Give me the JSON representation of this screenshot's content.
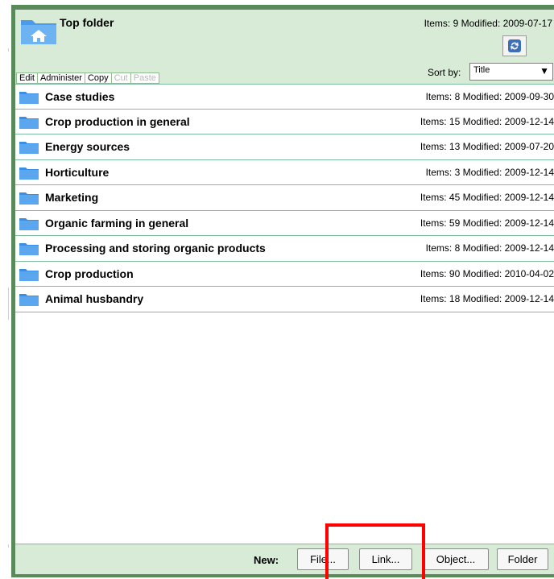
{
  "header": {
    "title": "Top folder",
    "meta": "Items: 9  Modified: 2009-07-17",
    "refresh_icon": "refresh-icon",
    "home_icon": "home-folder-icon",
    "sort_label": "Sort by:",
    "sort_value": "Title"
  },
  "actions": [
    {
      "label": "Edit",
      "enabled": true
    },
    {
      "label": "Administer",
      "enabled": true
    },
    {
      "label": "Copy",
      "enabled": true
    },
    {
      "label": "Cut",
      "enabled": false
    },
    {
      "label": "Paste",
      "enabled": false
    }
  ],
  "folders": [
    {
      "name": "Case studies",
      "meta": "Items: 8  Modified: 2009-09-30"
    },
    {
      "name": "Crop production in general",
      "meta": "Items: 15  Modified: 2009-12-14"
    },
    {
      "name": "Energy sources",
      "meta": "Items: 13  Modified: 2009-07-20"
    },
    {
      "name": "Horticulture",
      "meta": "Items: 3  Modified: 2009-12-14"
    },
    {
      "name": "Marketing",
      "meta": "Items: 45  Modified: 2009-12-14"
    },
    {
      "name": "Organic farming in general",
      "meta": "Items: 59  Modified: 2009-12-14"
    },
    {
      "name": "Processing and storing organic products",
      "meta": "Items: 8  Modified: 2009-12-14"
    },
    {
      "name": "Crop production",
      "meta": "Items: 90  Modified: 2010-04-02"
    },
    {
      "name": "Animal husbandry",
      "meta": "Items: 18  Modified: 2009-12-14"
    }
  ],
  "footer": {
    "new_label": "New:",
    "buttons": [
      "File...",
      "Link...",
      "Object...",
      "Folder"
    ]
  },
  "colors": {
    "frame": "#5a8a5a",
    "header_bg": "#d7ebd7",
    "row_border": "#7bbf9b",
    "folder_icon": "#3a8ee6",
    "highlight": "#ff0000"
  }
}
